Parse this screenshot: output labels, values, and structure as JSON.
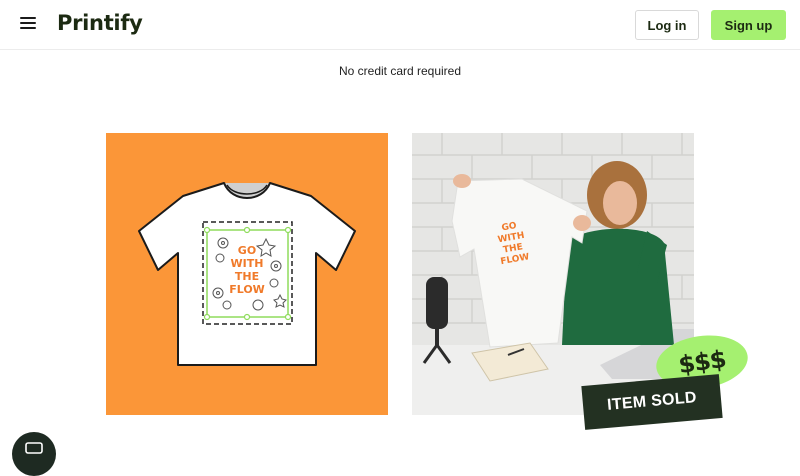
{
  "header": {
    "logo": "Printify",
    "login_label": "Log in",
    "signup_label": "Sign up"
  },
  "hero": {
    "note": "No credit card required"
  },
  "design": {
    "print_text": [
      "GO",
      "WITH",
      "THE",
      "FLOW"
    ]
  },
  "badges": {
    "money": "$$$",
    "sold": "ITEM SOLD"
  },
  "colors": {
    "brand_green": "#a5f070",
    "brand_dark": "#1c2a12",
    "orange": "#fb9638",
    "print_orange": "#f07a2a"
  },
  "icons": {
    "menu": "hamburger-menu-icon",
    "chat": "chat-icon"
  }
}
